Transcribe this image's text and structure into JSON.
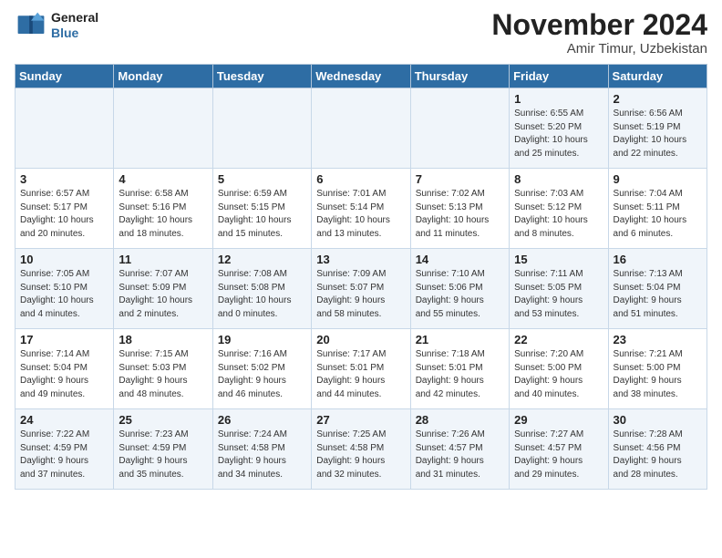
{
  "logo": {
    "general": "General",
    "blue": "Blue"
  },
  "title": "November 2024",
  "subtitle": "Amir Timur, Uzbekistan",
  "days_of_week": [
    "Sunday",
    "Monday",
    "Tuesday",
    "Wednesday",
    "Thursday",
    "Friday",
    "Saturday"
  ],
  "weeks": [
    [
      {
        "day": "",
        "info": ""
      },
      {
        "day": "",
        "info": ""
      },
      {
        "day": "",
        "info": ""
      },
      {
        "day": "",
        "info": ""
      },
      {
        "day": "",
        "info": ""
      },
      {
        "day": "1",
        "info": "Sunrise: 6:55 AM\nSunset: 5:20 PM\nDaylight: 10 hours\nand 25 minutes."
      },
      {
        "day": "2",
        "info": "Sunrise: 6:56 AM\nSunset: 5:19 PM\nDaylight: 10 hours\nand 22 minutes."
      }
    ],
    [
      {
        "day": "3",
        "info": "Sunrise: 6:57 AM\nSunset: 5:17 PM\nDaylight: 10 hours\nand 20 minutes."
      },
      {
        "day": "4",
        "info": "Sunrise: 6:58 AM\nSunset: 5:16 PM\nDaylight: 10 hours\nand 18 minutes."
      },
      {
        "day": "5",
        "info": "Sunrise: 6:59 AM\nSunset: 5:15 PM\nDaylight: 10 hours\nand 15 minutes."
      },
      {
        "day": "6",
        "info": "Sunrise: 7:01 AM\nSunset: 5:14 PM\nDaylight: 10 hours\nand 13 minutes."
      },
      {
        "day": "7",
        "info": "Sunrise: 7:02 AM\nSunset: 5:13 PM\nDaylight: 10 hours\nand 11 minutes."
      },
      {
        "day": "8",
        "info": "Sunrise: 7:03 AM\nSunset: 5:12 PM\nDaylight: 10 hours\nand 8 minutes."
      },
      {
        "day": "9",
        "info": "Sunrise: 7:04 AM\nSunset: 5:11 PM\nDaylight: 10 hours\nand 6 minutes."
      }
    ],
    [
      {
        "day": "10",
        "info": "Sunrise: 7:05 AM\nSunset: 5:10 PM\nDaylight: 10 hours\nand 4 minutes."
      },
      {
        "day": "11",
        "info": "Sunrise: 7:07 AM\nSunset: 5:09 PM\nDaylight: 10 hours\nand 2 minutes."
      },
      {
        "day": "12",
        "info": "Sunrise: 7:08 AM\nSunset: 5:08 PM\nDaylight: 10 hours\nand 0 minutes."
      },
      {
        "day": "13",
        "info": "Sunrise: 7:09 AM\nSunset: 5:07 PM\nDaylight: 9 hours\nand 58 minutes."
      },
      {
        "day": "14",
        "info": "Sunrise: 7:10 AM\nSunset: 5:06 PM\nDaylight: 9 hours\nand 55 minutes."
      },
      {
        "day": "15",
        "info": "Sunrise: 7:11 AM\nSunset: 5:05 PM\nDaylight: 9 hours\nand 53 minutes."
      },
      {
        "day": "16",
        "info": "Sunrise: 7:13 AM\nSunset: 5:04 PM\nDaylight: 9 hours\nand 51 minutes."
      }
    ],
    [
      {
        "day": "17",
        "info": "Sunrise: 7:14 AM\nSunset: 5:04 PM\nDaylight: 9 hours\nand 49 minutes."
      },
      {
        "day": "18",
        "info": "Sunrise: 7:15 AM\nSunset: 5:03 PM\nDaylight: 9 hours\nand 48 minutes."
      },
      {
        "day": "19",
        "info": "Sunrise: 7:16 AM\nSunset: 5:02 PM\nDaylight: 9 hours\nand 46 minutes."
      },
      {
        "day": "20",
        "info": "Sunrise: 7:17 AM\nSunset: 5:01 PM\nDaylight: 9 hours\nand 44 minutes."
      },
      {
        "day": "21",
        "info": "Sunrise: 7:18 AM\nSunset: 5:01 PM\nDaylight: 9 hours\nand 42 minutes."
      },
      {
        "day": "22",
        "info": "Sunrise: 7:20 AM\nSunset: 5:00 PM\nDaylight: 9 hours\nand 40 minutes."
      },
      {
        "day": "23",
        "info": "Sunrise: 7:21 AM\nSunset: 5:00 PM\nDaylight: 9 hours\nand 38 minutes."
      }
    ],
    [
      {
        "day": "24",
        "info": "Sunrise: 7:22 AM\nSunset: 4:59 PM\nDaylight: 9 hours\nand 37 minutes."
      },
      {
        "day": "25",
        "info": "Sunrise: 7:23 AM\nSunset: 4:59 PM\nDaylight: 9 hours\nand 35 minutes."
      },
      {
        "day": "26",
        "info": "Sunrise: 7:24 AM\nSunset: 4:58 PM\nDaylight: 9 hours\nand 34 minutes."
      },
      {
        "day": "27",
        "info": "Sunrise: 7:25 AM\nSunset: 4:58 PM\nDaylight: 9 hours\nand 32 minutes."
      },
      {
        "day": "28",
        "info": "Sunrise: 7:26 AM\nSunset: 4:57 PM\nDaylight: 9 hours\nand 31 minutes."
      },
      {
        "day": "29",
        "info": "Sunrise: 7:27 AM\nSunset: 4:57 PM\nDaylight: 9 hours\nand 29 minutes."
      },
      {
        "day": "30",
        "info": "Sunrise: 7:28 AM\nSunset: 4:56 PM\nDaylight: 9 hours\nand 28 minutes."
      }
    ]
  ]
}
